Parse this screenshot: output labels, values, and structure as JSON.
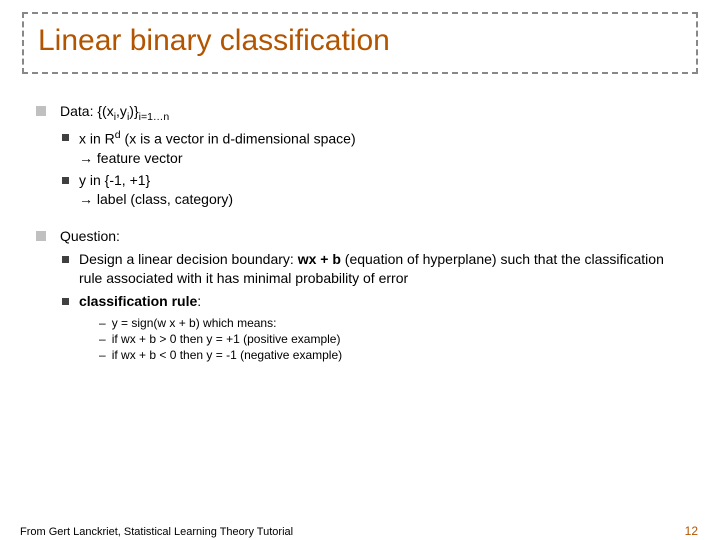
{
  "title": "Linear binary classification",
  "section1": {
    "heading_prefix": "Data: ",
    "heading_rest": "{(x",
    "heading_sub1": "i",
    "heading_mid": ",y",
    "heading_sub2": "i",
    "heading_close": ")}",
    "heading_sub3": "i=1…n",
    "items": [
      {
        "line1a": "x in R",
        "line1sup": "d",
        "line1b": "    (x is a vector in d-dimensional space)",
        "line2": "→ feature vector"
      },
      {
        "line1": "y in  {-1, +1}",
        "line2": "→ label (class, category)"
      }
    ]
  },
  "section2": {
    "heading": "Question:",
    "items": [
      {
        "text_a": "Design a linear decision boundary: ",
        "text_bold": "wx + b",
        "text_b": " (equation of hyperplane)  such that the classification rule associated with it has minimal probability of error"
      },
      {
        "text_bold": "classification rule",
        "text_after": ":"
      }
    ],
    "dashes": [
      "y = sign(w x + b) which means:",
      "if wx + b > 0 then y = +1 (positive example)",
      "if wx + b < 0 then y = -1  (negative example)"
    ]
  },
  "footer": "From Gert Lanckriet, Statistical Learning Theory Tutorial",
  "pagenum": "12"
}
